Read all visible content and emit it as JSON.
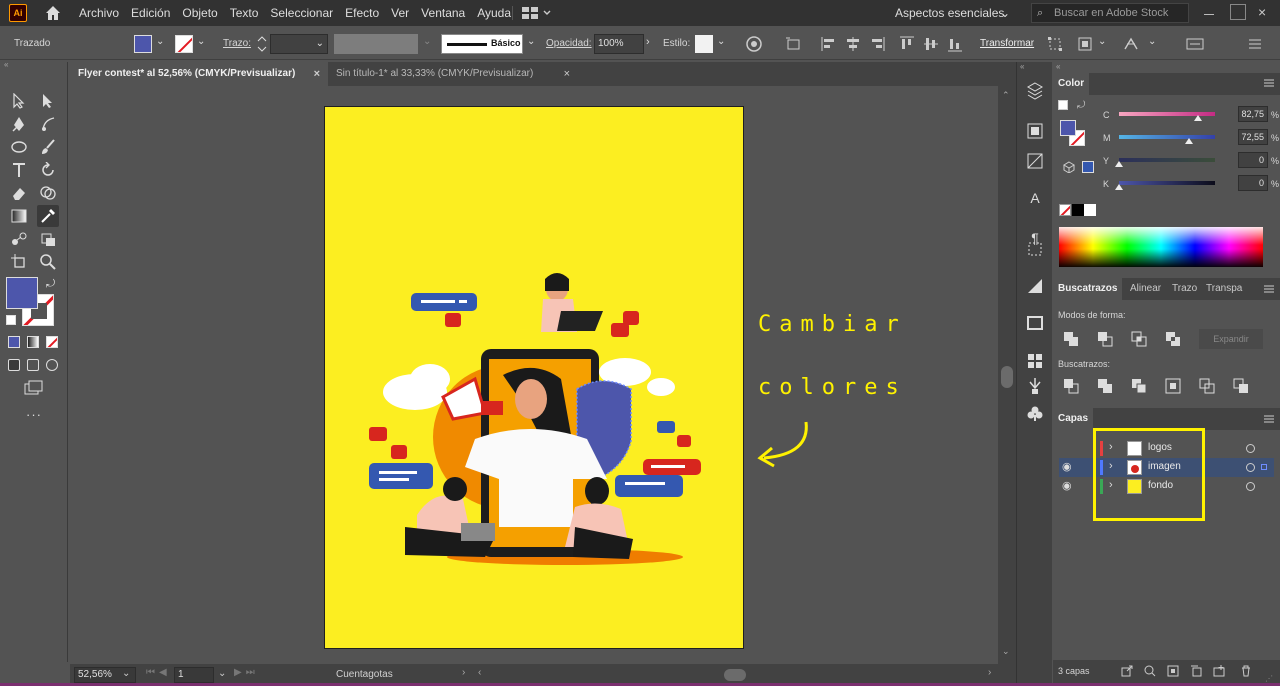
{
  "app": {
    "logo": "Ai"
  },
  "menu": [
    "Archivo",
    "Edición",
    "Objeto",
    "Texto",
    "Seleccionar",
    "Efecto",
    "Ver",
    "Ventana",
    "Ayuda"
  ],
  "workspace": "Aspectos esenciales",
  "search": {
    "placeholder": "Buscar en Adobe Stock"
  },
  "control_bar": {
    "object_type": "Trazado",
    "stroke_label": "Trazo:",
    "brush_label": "Básico",
    "opacity_label": "Opacidad:",
    "opacity_value": "100%",
    "style_label": "Estilo:",
    "transform_label": "Transformar",
    "fill_color": "#4d56ab"
  },
  "tabs": [
    {
      "label": "Flyer contest* al 52,56% (CMYK/Previsualizar)",
      "close": "×",
      "active": true
    },
    {
      "label": "Sin título-1* al 33,33% (CMYK/Previsualizar)",
      "close": "×",
      "active": false
    }
  ],
  "canvas": {
    "artboard_color": "#fcee21",
    "annotation_line1": "Cambiar",
    "annotation_line2": "colores"
  },
  "color_panel": {
    "title": "Color",
    "channels": [
      {
        "label": "C",
        "value": "82,75",
        "unit": "%",
        "level": 0.8275
      },
      {
        "label": "M",
        "value": "72,55",
        "unit": "%",
        "level": 0.7255
      },
      {
        "label": "Y",
        "value": "0",
        "unit": "%",
        "level": 0
      },
      {
        "label": "K",
        "value": "0",
        "unit": "%",
        "level": 0
      }
    ]
  },
  "pathfinder_panel": {
    "tabs": [
      "Buscatrazos",
      "Alinear",
      "Trazo",
      "Transpa"
    ],
    "shape_modes_label": "Modos de forma:",
    "expand_label": "Expandir",
    "pathfinders_label": "Buscatrazos:"
  },
  "layers_panel": {
    "title": "Capas",
    "layers": [
      {
        "name": "logos",
        "visible": false,
        "color": "#e64040",
        "selected": false
      },
      {
        "name": "imagen",
        "visible": true,
        "color": "#4f79ff",
        "selected": true
      },
      {
        "name": "fondo",
        "visible": true,
        "color": "#3aa856",
        "selected": false
      }
    ],
    "count": "3 capas"
  },
  "status_bar": {
    "zoom": "52,56%",
    "artboard_number": "1",
    "tool_name": "Cuentagotas"
  }
}
